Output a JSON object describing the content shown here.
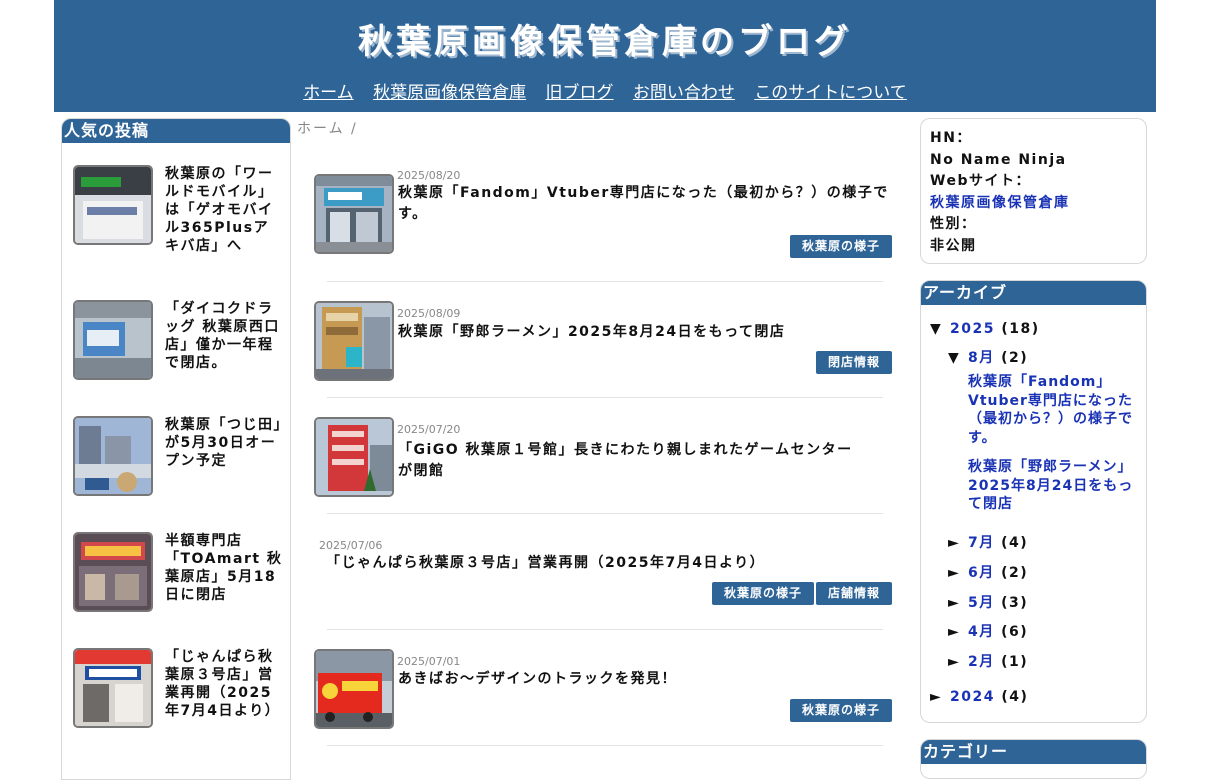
{
  "header": {
    "title": "秋葉原画像保管倉庫のブログ",
    "nav": [
      "ホーム",
      "秋葉原画像保管倉庫",
      "旧ブログ",
      "お問い合わせ",
      "このサイトについて"
    ]
  },
  "popular": {
    "title": "人気の投稿",
    "items": [
      {
        "text": "秋葉原の「ワールドモバイル」は「ゲオモバイル365Plusアキバ店」へ"
      },
      {
        "text": "「ダイコクドラッグ 秋葉原西口店」僅か一年程で閉店。"
      },
      {
        "text": "秋葉原「つじ田」が5月30日オープン予定"
      },
      {
        "text": "半額専門店「TOAmart 秋葉原店」5月18日に閉店"
      },
      {
        "text": "「じゃんぱら秋葉原３号店」営業再開（2025年7月4日より）"
      }
    ]
  },
  "breadcrumb": "ホーム /",
  "posts": [
    {
      "date": "2025/08/20",
      "title": "秋葉原「Fandom」Vtuber専門店になった（最初から？）の様子です。",
      "tags": [
        "秋葉原の様子"
      ]
    },
    {
      "date": "2025/08/09",
      "title": "秋葉原「野郎ラーメン」2025年8月24日をもって閉店",
      "tags": [
        "閉店情報"
      ]
    },
    {
      "date": "2025/07/20",
      "title": "「GiGO 秋葉原１号館」長きにわたり親しまれたゲームセンターが閉館",
      "tags": []
    },
    {
      "date": "2025/07/06",
      "title": "「じゃんぱら秋葉原３号店」営業再開（2025年7月4日より）",
      "tags": [
        "秋葉原の様子",
        "店舗情報"
      ]
    },
    {
      "date": "2025/07/01",
      "title": "あきばお～デザインのトラックを発見！",
      "tags": [
        "秋葉原の様子"
      ]
    }
  ],
  "profile": {
    "hn_label": "HN：",
    "hn": "No Name Ninja",
    "web_label": "Webサイト：",
    "web": "秋葉原画像保管倉庫",
    "sex_label": "性別：",
    "sex": "非公開"
  },
  "archive": {
    "title": "アーカイブ",
    "y2025": {
      "year": "2025",
      "count": "(18)"
    },
    "aug": {
      "month": "8月",
      "count": "(2)"
    },
    "aug_posts": [
      "秋葉原「Fandom」Vtuber専門店になった（最初から？）の様子です。",
      "秋葉原「野郎ラーメン」2025年8月24日をもって閉店"
    ],
    "months": [
      {
        "month": "7月",
        "count": "(4)"
      },
      {
        "month": "6月",
        "count": "(2)"
      },
      {
        "month": "5月",
        "count": "(3)"
      },
      {
        "month": "4月",
        "count": "(6)"
      },
      {
        "month": "2月",
        "count": "(1)"
      }
    ],
    "y2024": {
      "year": "2024",
      "count": "(4)"
    },
    "expanded_glyph": "▼",
    "collapsed_glyph": "►"
  },
  "category": {
    "title": "カテゴリー"
  },
  "colors": {
    "brand": "#2f6497",
    "link": "#1a33b5"
  }
}
